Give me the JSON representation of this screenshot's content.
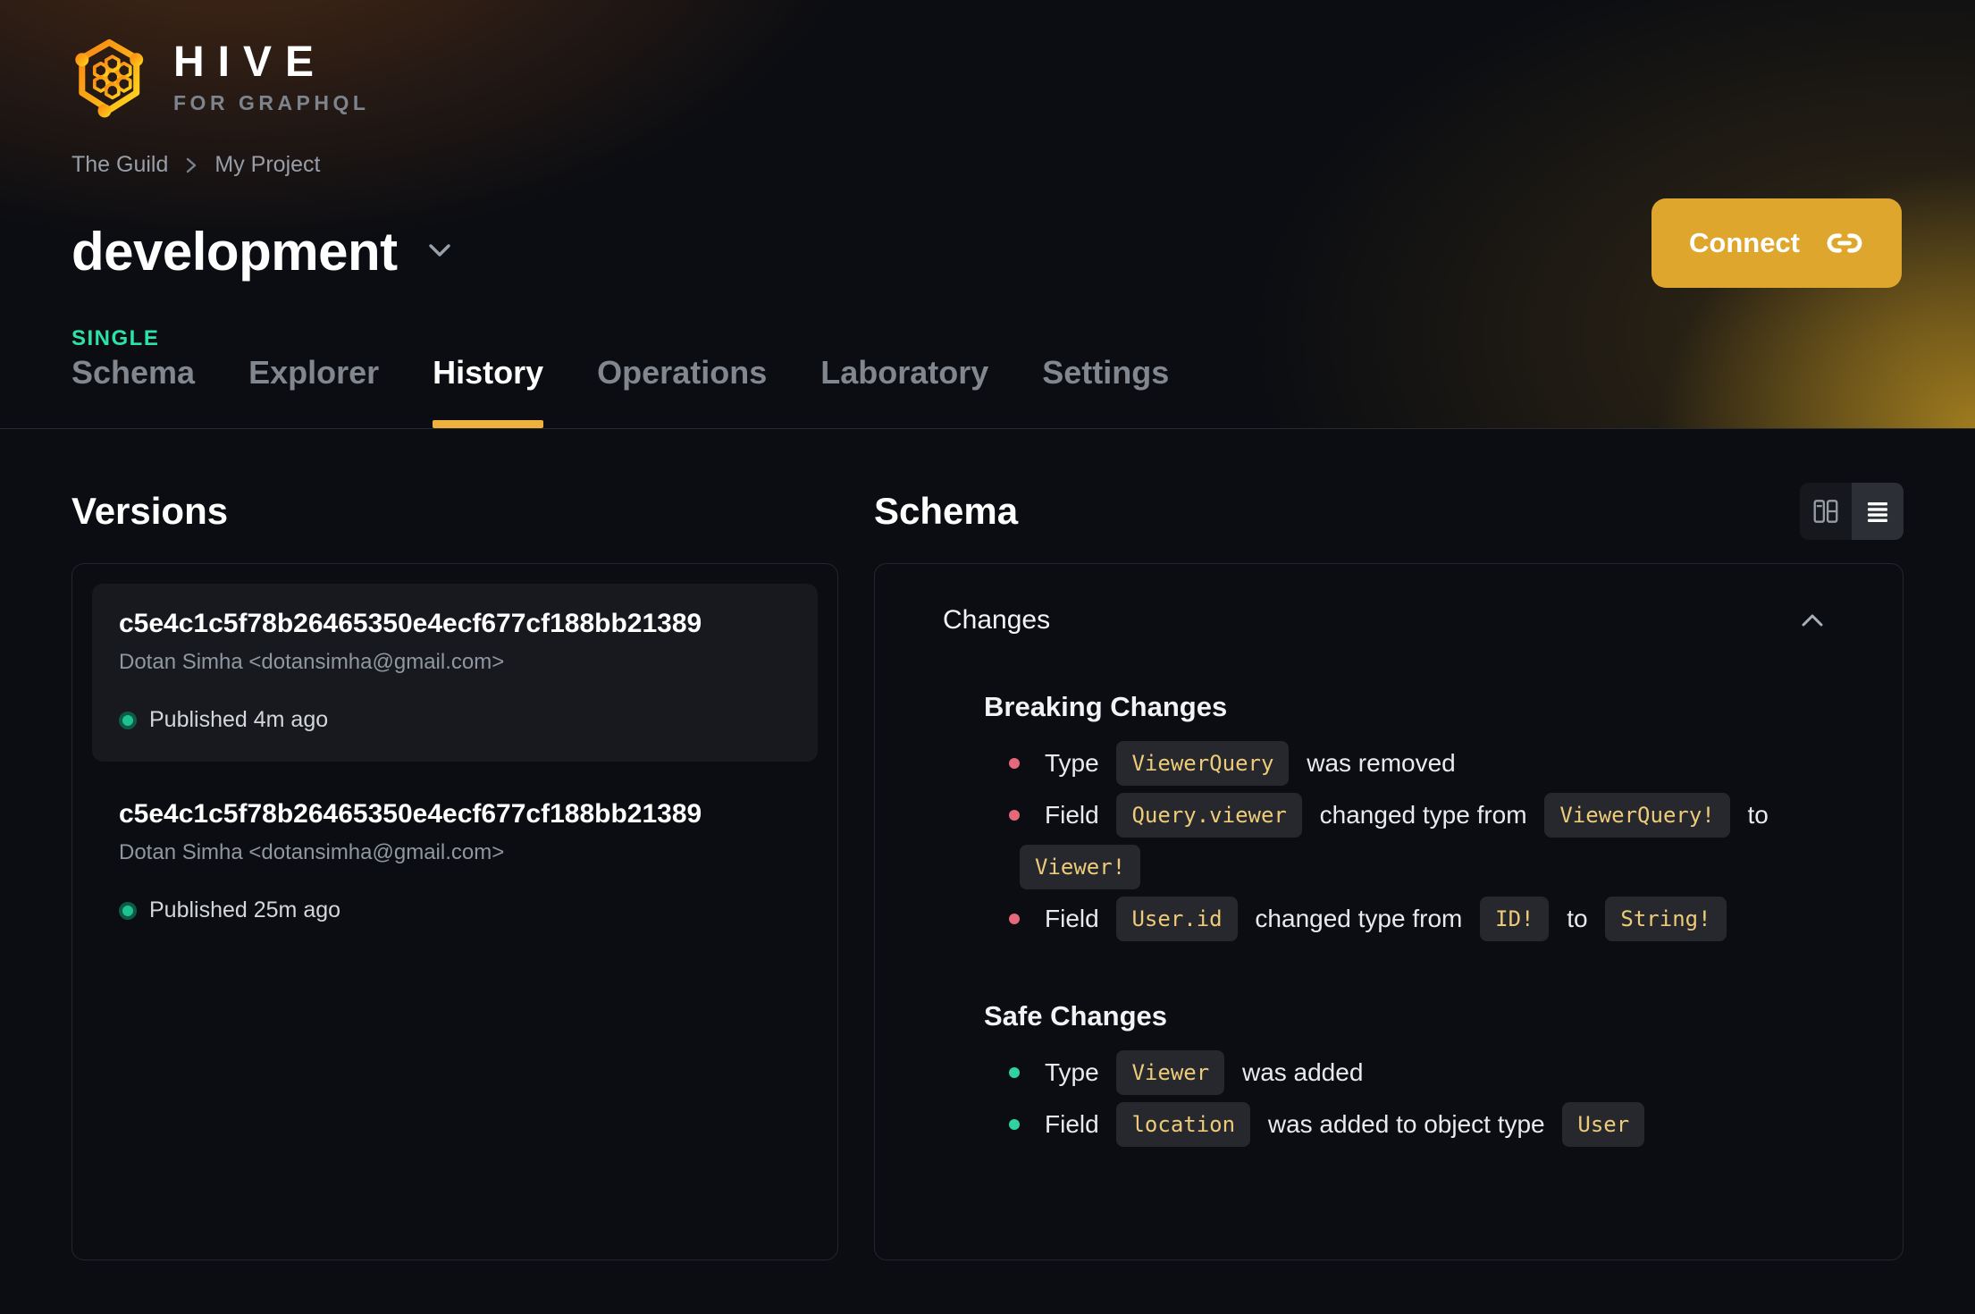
{
  "brand": {
    "name": "HIVE",
    "tagline": "FOR GRAPHQL"
  },
  "breadcrumb": {
    "items": [
      "The Guild",
      "My Project"
    ]
  },
  "project": {
    "title": "development",
    "badge": "SINGLE"
  },
  "actions": {
    "connect_label": "Connect"
  },
  "tabs": [
    {
      "label": "Schema",
      "active": false
    },
    {
      "label": "Explorer",
      "active": false
    },
    {
      "label": "History",
      "active": true
    },
    {
      "label": "Operations",
      "active": false
    },
    {
      "label": "Laboratory",
      "active": false
    },
    {
      "label": "Settings",
      "active": false
    }
  ],
  "versions": {
    "heading": "Versions",
    "items": [
      {
        "hash": "c5e4c1c5f78b26465350e4ecf677cf188bb21389",
        "author": "Dotan Simha <dotansimha@gmail.com>",
        "status": "Published 4m ago",
        "selected": true
      },
      {
        "hash": "c5e4c1c5f78b26465350e4ecf677cf188bb21389",
        "author": "Dotan Simha <dotansimha@gmail.com>",
        "status": "Published 25m ago",
        "selected": false
      }
    ]
  },
  "schema_panel": {
    "heading": "Schema",
    "view_toggle": {
      "options": [
        {
          "icon": "columns-view-icon",
          "active": false
        },
        {
          "icon": "list-view-icon",
          "active": true
        }
      ]
    },
    "changes": {
      "title": "Changes",
      "sections": [
        {
          "title": "Breaking Changes",
          "severity": "breaking",
          "items": [
            [
              {
                "code": false,
                "text": "Type"
              },
              {
                "code": true,
                "text": "ViewerQuery"
              },
              {
                "code": false,
                "text": "was removed"
              }
            ],
            [
              {
                "code": false,
                "text": "Field"
              },
              {
                "code": true,
                "text": "Query.viewer"
              },
              {
                "code": false,
                "text": "changed type from"
              },
              {
                "code": true,
                "text": "ViewerQuery!"
              },
              {
                "code": false,
                "text": "to"
              },
              {
                "code": true,
                "text": "Viewer!"
              }
            ],
            [
              {
                "code": false,
                "text": "Field"
              },
              {
                "code": true,
                "text": "User.id"
              },
              {
                "code": false,
                "text": "changed type from"
              },
              {
                "code": true,
                "text": "ID!"
              },
              {
                "code": false,
                "text": "to"
              },
              {
                "code": true,
                "text": "String!"
              }
            ]
          ]
        },
        {
          "title": "Safe Changes",
          "severity": "safe",
          "items": [
            [
              {
                "code": false,
                "text": "Type"
              },
              {
                "code": true,
                "text": "Viewer"
              },
              {
                "code": false,
                "text": "was added"
              }
            ],
            [
              {
                "code": false,
                "text": "Field"
              },
              {
                "code": true,
                "text": "location"
              },
              {
                "code": false,
                "text": "was added to object type"
              },
              {
                "code": true,
                "text": "User"
              }
            ]
          ]
        }
      ]
    }
  },
  "icons": {
    "connect": "link-icon",
    "title_dropdown": "chevron-down-icon",
    "changes_collapse": "chevron-up-icon",
    "published": "green-dot-icon",
    "view_modes": [
      "columns-view-icon",
      "list-view-icon"
    ]
  },
  "colors": {
    "accent_button": "#dfa62e",
    "tab_underline": "#efb13d",
    "badge_green": "#2ce3a7",
    "published_dot": "#1ec28e",
    "breaking_bullet": "#e5697a",
    "safe_bullet": "#2fd3a0",
    "code_text": "#eecb78"
  }
}
